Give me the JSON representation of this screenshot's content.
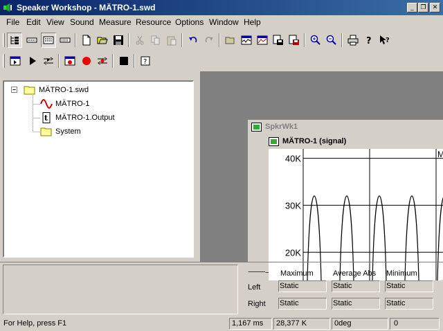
{
  "window": {
    "title": "Speaker Workshop - MÄTRO-1.swd",
    "minimize": "0",
    "maximize": "1",
    "close": "r"
  },
  "menu": [
    "File",
    "Edit",
    "View",
    "Sound",
    "Measure",
    "Resource",
    "Options",
    "Window",
    "Help"
  ],
  "toolbar1": [
    "tree-view-icon",
    "list-view-icon",
    "detail-view-icon",
    "small-view-icon",
    "new-file-icon",
    "open-folder-icon",
    "save-icon",
    "cut-icon",
    "copy-icon",
    "paste-icon",
    "undo-icon",
    "redo-icon",
    "open-resource-icon",
    "signal-view-icon",
    "chart-view-icon",
    "export-icon",
    "import-icon",
    "zoom-in-icon",
    "zoom-out-icon",
    "print-icon",
    "help-icon",
    "context-help-icon"
  ],
  "toolbar2": [
    "play-window-icon",
    "play-icon",
    "loop-play-icon",
    "record-window-icon",
    "record-icon",
    "loop-record-icon",
    "stop-icon",
    "calibrate-icon"
  ],
  "tree": {
    "root": "MÄTRO-1.swd",
    "items": [
      {
        "label": "MÄTRO-1",
        "icon": "signal-wave-icon"
      },
      {
        "label": "MÄTRO-1.Output",
        "icon": "text-file-icon"
      },
      {
        "label": "System",
        "icon": "folder-icon"
      }
    ]
  },
  "mdi": {
    "outer_title": "SpkrWk1",
    "inner_title": "MÄTRO-1 (signal)",
    "corner_label": "M"
  },
  "chart_data": {
    "type": "line",
    "title": "",
    "xlabel": "",
    "ylabel": "",
    "yticks": [
      "40K",
      "30K",
      "20K"
    ],
    "ylim": [
      14000,
      42000
    ],
    "series": [
      {
        "values": [
          0,
          32000,
          0,
          0,
          32000,
          0,
          0,
          32000,
          0,
          0,
          32000,
          0,
          0,
          32000
        ]
      }
    ]
  },
  "stats": {
    "columns": [
      "Maximum",
      "Average Abs",
      "Minimum"
    ],
    "rows": [
      {
        "label": "Left",
        "values": [
          "Static",
          "Static",
          "Static"
        ]
      },
      {
        "label": "Right",
        "values": [
          "Static",
          "Static",
          "Static"
        ]
      }
    ]
  },
  "status": {
    "help": "For Help, press F1",
    "time": "1,167  ms",
    "count": "28,377 K",
    "angle": "0deg",
    "value": "0"
  }
}
